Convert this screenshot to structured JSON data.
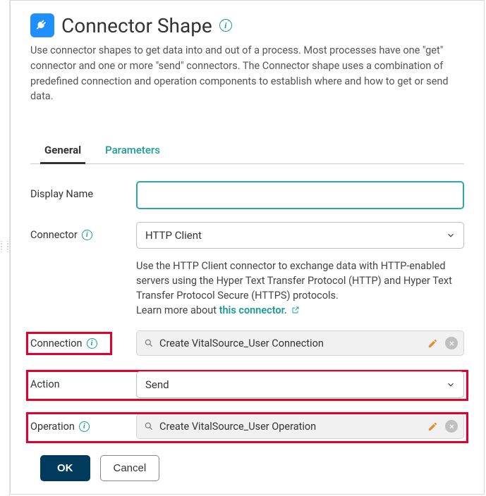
{
  "header": {
    "title": "Connector Shape",
    "intro": "Use connector shapes to get data into and out of a process. Most processes have one \"get\" connector and one or more \"send\" connectors. The Connector shape uses a combination of predefined connection and operation components to establish where and how to get or send data."
  },
  "tabs": {
    "general": "General",
    "parameters": "Parameters"
  },
  "form": {
    "display_name_label": "Display Name",
    "display_name_value": "",
    "connector_label": "Connector",
    "connector_value": "HTTP Client",
    "connector_help": "Use the HTTP Client connector to exchange data with HTTP-enabled servers using the Hyper Text Transfer Protocol (HTTP) and Hyper Text Transfer Protocol Secure (HTTPS) protocols.",
    "connector_help_prefix": "Learn more about ",
    "connector_help_link": "this connector.",
    "connection_label": "Connection",
    "connection_value": "Create VitalSource_User Connection",
    "action_label": "Action",
    "action_value": "Send",
    "operation_label": "Operation",
    "operation_value": "Create VitalSource_User Operation"
  },
  "buttons": {
    "ok": "OK",
    "cancel": "Cancel"
  }
}
